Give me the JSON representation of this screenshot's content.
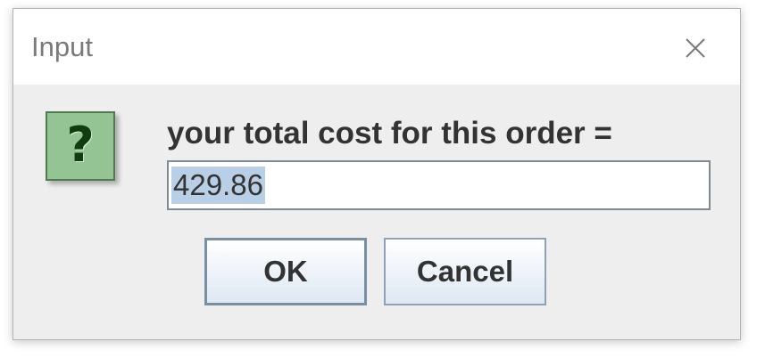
{
  "dialog": {
    "title": "Input",
    "message": "your total cost for this order =",
    "input_value": "429.86",
    "input_text_selected": true,
    "ok_label": "OK",
    "cancel_label": "Cancel",
    "question_glyph": "?",
    "icons": {
      "close": "close-icon",
      "question": "question-icon"
    },
    "colors": {
      "background": "#eeeeee",
      "titlebar": "#ffffff",
      "icon_fill": "#94c494",
      "selection": "#b8cfe5"
    }
  }
}
